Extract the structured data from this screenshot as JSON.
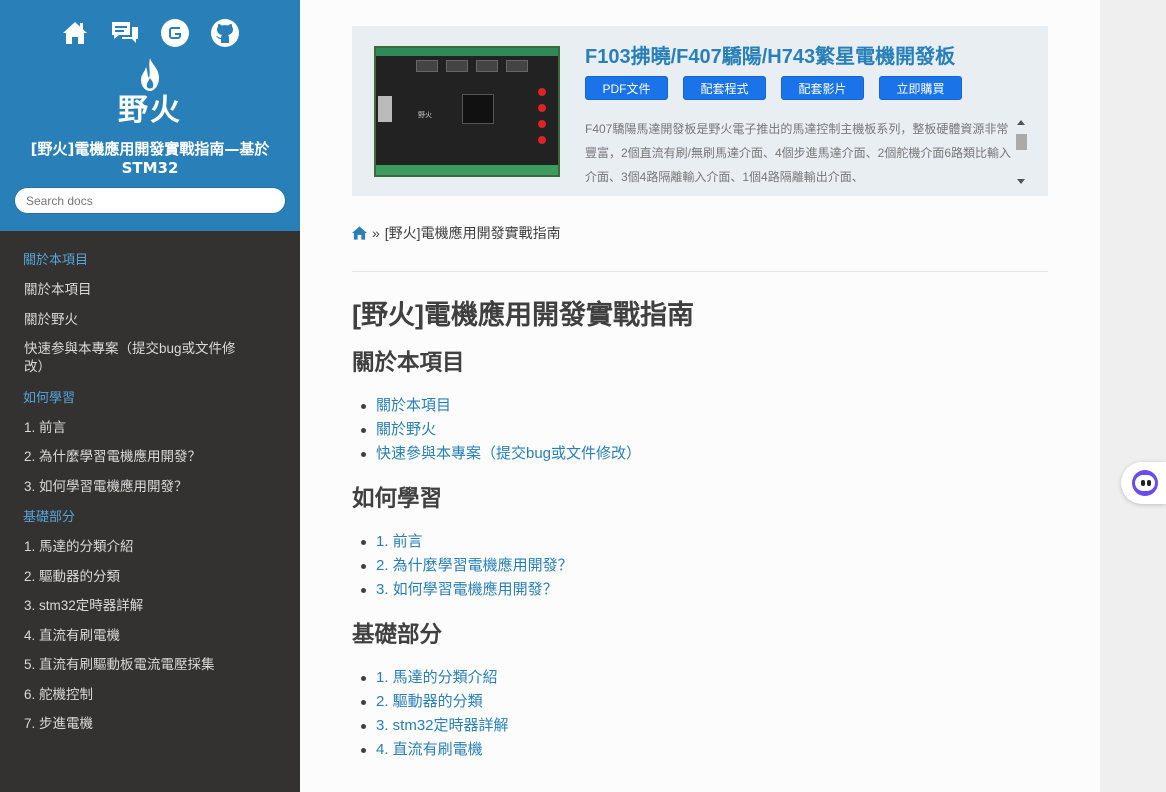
{
  "sidebar": {
    "logo_text": "野火",
    "project_title": "[野火]電機應用開發實戰指南—基於STM32",
    "search_placeholder": "Search docs",
    "sections": [
      {
        "caption": "關於本項目",
        "items": [
          "關於本項目",
          "關於野火",
          "快速参與本專案（提交bug或文件修改）"
        ]
      },
      {
        "caption": "如何學習",
        "items": [
          "1. 前言",
          "2. 為什麼學習電機應用開發？",
          "3. 如何學習電機應用開發？"
        ]
      },
      {
        "caption": "基礎部分",
        "items": [
          "1. 馬達的分類介紹",
          "2. 驅動器的分類",
          "3. stm32定時器詳解",
          "4. 直流有刷電機",
          "5. 直流有刷驅動板電流電壓採集",
          "6. 舵機控制",
          "7. 步進電機"
        ]
      }
    ]
  },
  "banner": {
    "title": "F103拂曉/F407驕陽/H743繁星電機開發板",
    "buttons": [
      "PDF文件",
      "配套程式",
      "配套影片",
      "立即購買"
    ],
    "board_label": "野火",
    "description": "F407驕陽馬達開發板是野火電子推出的馬達控制主機板系列，整板硬體資源非常豐富，2個直流有刷/無刷馬達介面、4個步進馬達介面、2個舵機介面6路類比輸入介面、3個4路隔離輸入介面、1個4路隔離輸出介面、"
  },
  "breadcrumb": {
    "separator": "»",
    "current": "[野火]電機應用開發實戰指南"
  },
  "doc": {
    "title": "[野火]電機應用開發實戰指南",
    "sections": [
      {
        "heading": "關於本項目",
        "links": [
          "關於本項目",
          "關於野火",
          "快速參與本專案（提交bug或文件修改）"
        ]
      },
      {
        "heading": "如何學習",
        "links": [
          "1. 前言",
          "2. 為什麼學習電機應用開發？",
          "3. 如何學習電機應用開發？"
        ]
      },
      {
        "heading": "基礎部分",
        "links": [
          "1. 馬達的分類介紹",
          "2. 驅動器的分類",
          "3. stm32定時器詳解",
          "4. 直流有刷電機"
        ]
      }
    ]
  },
  "colors": {
    "sidebar_top": "#2980b9",
    "sidebar_bg": "#343131",
    "caption": "#55a5d9",
    "link": "#2980b9",
    "button": "#1a73e8",
    "banner_bg": "#e9eef3"
  },
  "icons": [
    "home-icon",
    "chat-icon",
    "gitee-icon",
    "github-icon",
    "flame-logo-icon",
    "breadcrumb-home-icon",
    "chatbot-icon"
  ]
}
